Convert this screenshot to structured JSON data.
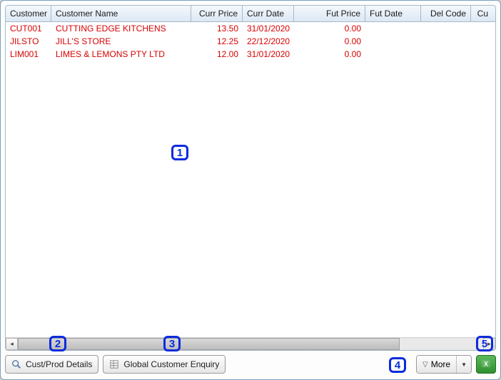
{
  "columns": {
    "customer": "Customer",
    "name": "Customer Name",
    "currprice": "Curr Price",
    "currdate": "Curr Date",
    "futprice": "Fut Price",
    "futdate": "Fut Date",
    "delcode": "Del Code",
    "cu": "Cu"
  },
  "rows": [
    {
      "customer": "CUT001",
      "name": "CUTTING EDGE KITCHENS",
      "currprice": "13.50",
      "currdate": "31/01/2020",
      "futprice": "0.00",
      "futdate": "",
      "delcode": ""
    },
    {
      "customer": "JILSTO",
      "name": "JILL'S STORE",
      "currprice": "12.25",
      "currdate": "22/12/2020",
      "futprice": "0.00",
      "futdate": "",
      "delcode": ""
    },
    {
      "customer": "LIM001",
      "name": "LIMES & LEMONS PTY LTD",
      "currprice": "12.00",
      "currdate": "31/01/2020",
      "futprice": "0.00",
      "futdate": "",
      "delcode": ""
    }
  ],
  "toolbar": {
    "custprod": "Cust/Prod Details",
    "global": "Global Customer Enquiry",
    "more": "More"
  },
  "annot": {
    "a1": "1",
    "a2": "2",
    "a3": "3",
    "a4": "4",
    "a5": "5"
  }
}
